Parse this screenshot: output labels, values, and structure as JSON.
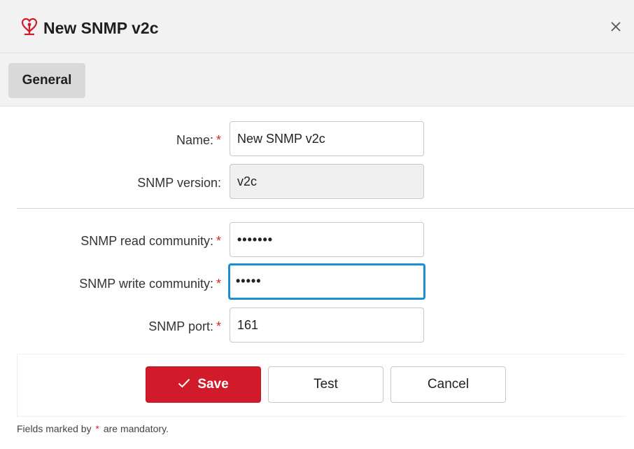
{
  "dialog": {
    "title": "New SNMP v2c",
    "close_symbol": "✕",
    "icon": "snmp-device-icon",
    "accent_color": "#d11a2a"
  },
  "tabs": [
    {
      "label": "General",
      "selected": true
    }
  ],
  "form": {
    "required_marker": "*",
    "fields": {
      "name": {
        "label": "Name:",
        "value": "New SNMP v2c",
        "required": true
      },
      "snmp_version": {
        "label": "SNMP version:",
        "value": "v2c",
        "readonly": true
      },
      "read_community": {
        "label": "SNMP read community:",
        "masked_value": "•••••••",
        "required": true
      },
      "write_community": {
        "label": "SNMP write community:",
        "masked_value": "•••••",
        "required": true,
        "focused": true
      },
      "port": {
        "label": "SNMP port:",
        "value": "161",
        "required": true
      }
    }
  },
  "buttons": {
    "save": "Save",
    "test": "Test",
    "cancel": "Cancel"
  },
  "footnote": {
    "prefix": "Fields marked by",
    "marker": "*",
    "suffix": "are mandatory."
  }
}
